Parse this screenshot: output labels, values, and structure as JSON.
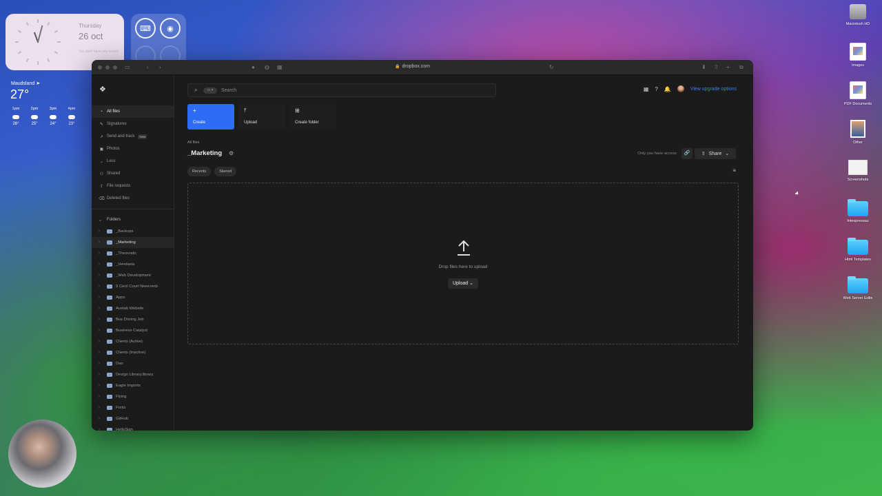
{
  "clock_widget": {
    "day": "Thursday",
    "date": "26 oct",
    "note": "You don't have any events"
  },
  "weather_widget": {
    "location": "Maudsland",
    "temperature": "27°",
    "hours": [
      {
        "time": "1pm",
        "temp": "26°"
      },
      {
        "time": "2pm",
        "temp": "25°"
      },
      {
        "time": "3pm",
        "temp": "24°"
      },
      {
        "time": "4pm",
        "temp": "23°"
      }
    ]
  },
  "desktop_icons": [
    {
      "label": "Macintosh HD",
      "icon": "drive-icon"
    },
    {
      "label": "Images",
      "icon": "document-icon"
    },
    {
      "label": "PDF Documents",
      "icon": "document-icon"
    },
    {
      "label": "Other",
      "icon": "photo-icon"
    },
    {
      "label": "Screenshots",
      "icon": "screenshot-icon"
    },
    {
      "label": "Intexpressau",
      "icon": "folder-icon"
    },
    {
      "label": "Html Templates",
      "icon": "folder-icon"
    },
    {
      "label": "Web Server Edits",
      "icon": "folder-icon"
    }
  ],
  "browser": {
    "url": "dropbox.com"
  },
  "sidebar": {
    "nav": [
      {
        "label": "All files",
        "icon": "files-icon",
        "active": true
      },
      {
        "label": "Signatures",
        "icon": "signature-icon"
      },
      {
        "label": "Send and track",
        "icon": "send-icon",
        "badge": "New"
      },
      {
        "label": "Photos",
        "icon": "photo-icon"
      },
      {
        "label": "Less",
        "icon": "chevron-up-icon"
      },
      {
        "label": "Shared",
        "icon": "shared-icon"
      },
      {
        "label": "File requests",
        "icon": "request-icon"
      },
      {
        "label": "Deleted files",
        "icon": "trash-icon"
      }
    ],
    "folders_heading": "Folders",
    "folders": [
      "_Backups",
      "_Marketing",
      "_Theocratic",
      "_Vendasta",
      "_Web Development",
      "9 Cecil Court Newcomb",
      "Apps",
      "Austab Website",
      "Bus Driving Job",
      "Business Catalyst",
      "Clients (Active)",
      "Clients (Inactive)",
      "Dan",
      "Design Library.library",
      "Eagle Imports",
      "Flying",
      "Fonts",
      "GitHub",
      "HelloSign"
    ],
    "active_folder": "_Marketing"
  },
  "header": {
    "search_placeholder": "Search",
    "upgrade_label": "View upgrade options"
  },
  "actions": {
    "create": "Create",
    "upload": "Upload",
    "create_folder": "Create folder"
  },
  "content": {
    "breadcrumb": "All files",
    "title": "_Marketing",
    "access_text": "Only you have access",
    "share_label": "Share",
    "tabs": [
      "Recents",
      "Starred"
    ],
    "drop_text": "Drop files here to upload",
    "upload_label": "Upload"
  }
}
